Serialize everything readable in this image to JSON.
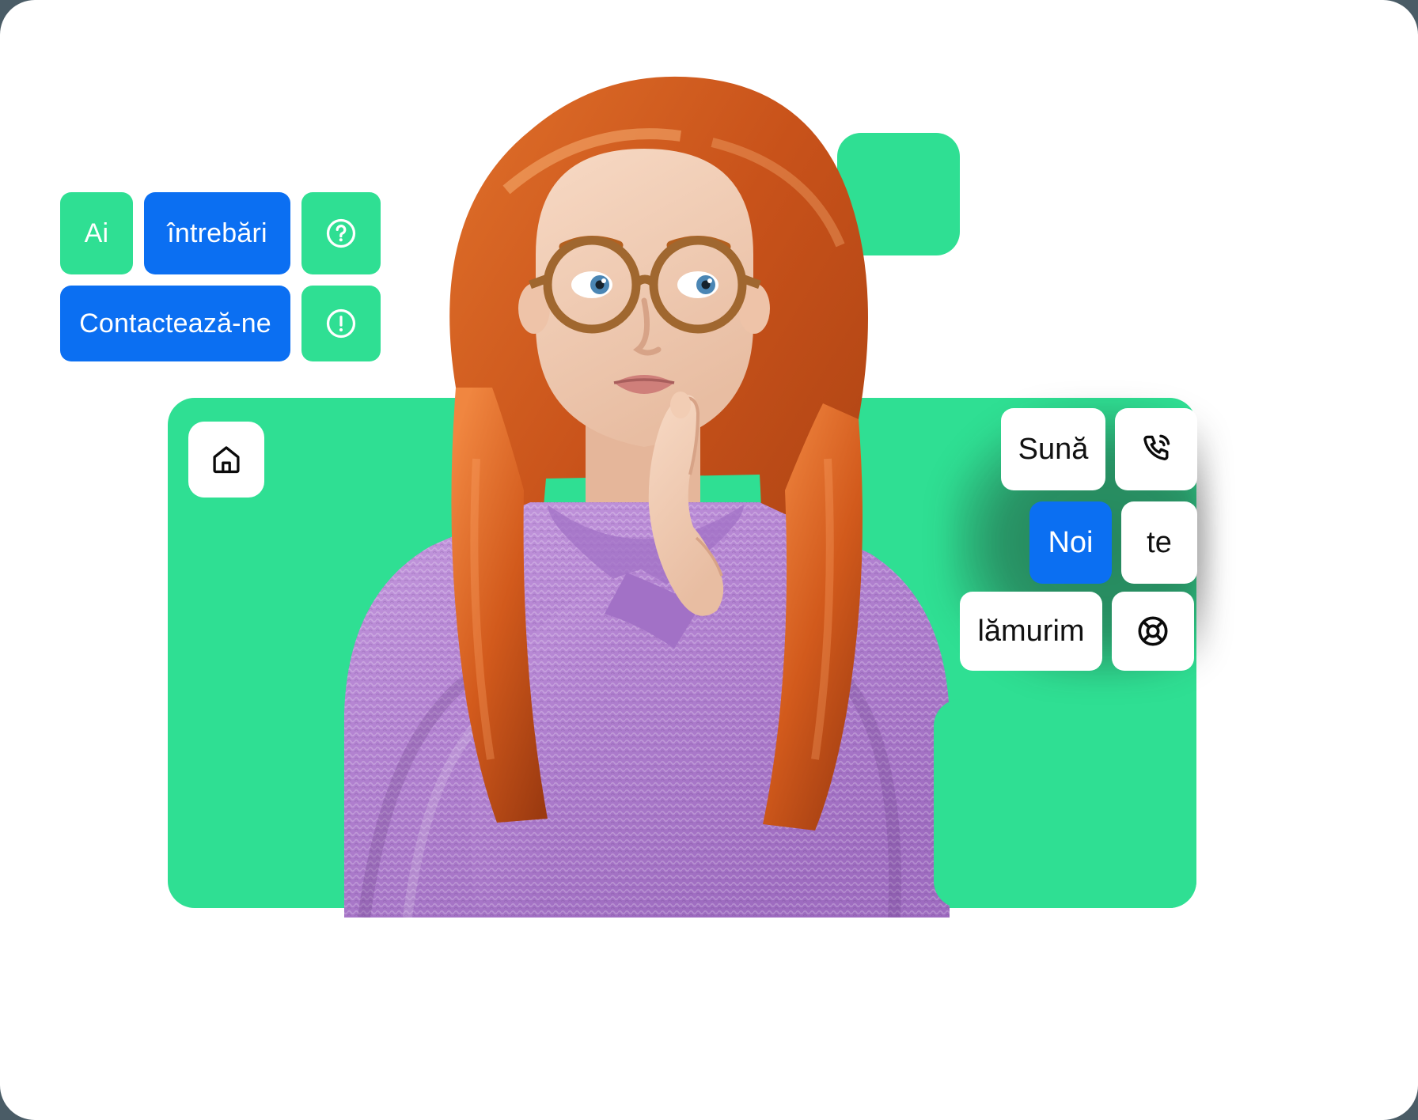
{
  "page": {
    "title": "Ai întrebări? Contactează-ne",
    "language": "ro"
  },
  "colors": {
    "backdrop": "#4a5c66",
    "card": "#ffffff",
    "green": "#2fdf93",
    "blue": "#0b6ff2",
    "text_dark": "#111111",
    "text_light": "#ffffff",
    "sweater": "#b07fd0",
    "hair": "#cc5a1e"
  },
  "word_tiles": {
    "row1": [
      {
        "label": "Ai",
        "style": "green",
        "name": "tile-ai"
      },
      {
        "label": "întrebări",
        "style": "blue",
        "name": "tile-intrebari"
      },
      {
        "label": "",
        "style": "green",
        "icon": "question-circle-icon",
        "name": "tile-help-icon"
      }
    ],
    "row2": [
      {
        "label": "Contactează-ne",
        "style": "blue",
        "name": "tile-contact"
      },
      {
        "label": "",
        "style": "green",
        "icon": "exclamation-circle-icon",
        "name": "tile-alert-icon"
      }
    ]
  },
  "home_tile": {
    "icon": "home-icon",
    "label": ""
  },
  "key_cluster": {
    "keys": [
      {
        "label": "Sună",
        "style": "white",
        "name": "key-suna"
      },
      {
        "label": "",
        "style": "white",
        "icon": "phone-ring-icon",
        "name": "key-phone"
      },
      {
        "label": "Noi",
        "style": "blue",
        "name": "key-noi"
      },
      {
        "label": "te",
        "style": "white",
        "name": "key-te"
      },
      {
        "label": "lămurim",
        "style": "white",
        "name": "key-lamurim"
      },
      {
        "label": "",
        "style": "white",
        "icon": "life-buoy-icon",
        "name": "key-support"
      }
    ]
  },
  "decorations": {
    "green_square_top": "green-square-top",
    "green_card_main": "green-card-main",
    "green_card_bottom_right": "green-card-bottom-right"
  },
  "person": {
    "description": "Woman with long red hair and tortoiseshell glasses wearing a purple knit sweater, index finger on lips, thinking",
    "alt": "Femeie gânditoare cu ochelari"
  }
}
